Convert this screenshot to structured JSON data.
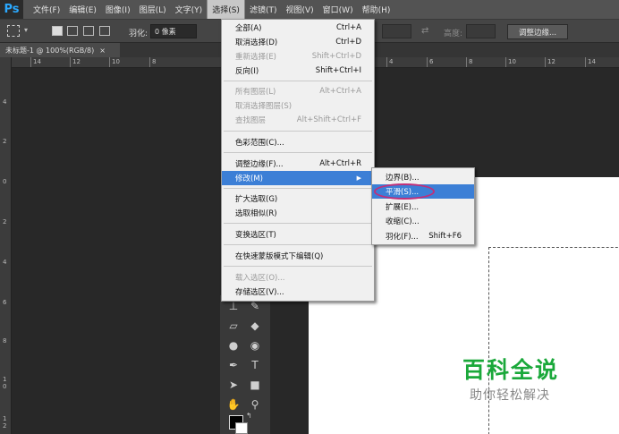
{
  "menubar": {
    "logo": "Ps",
    "items": [
      "文件(F)",
      "编辑(E)",
      "图像(I)",
      "图层(L)",
      "文字(Y)",
      "选择(S)",
      "滤镜(T)",
      "视图(V)",
      "窗口(W)",
      "帮助(H)"
    ],
    "active": "选择(S)"
  },
  "options": {
    "feather_label": "羽化:",
    "feather_value": "0 像素",
    "height_label": "高度:",
    "refine_button": "调整边缘..."
  },
  "document": {
    "tab_title": "未标题-1 @ 100%(RGB/8)",
    "close_glyph": "×"
  },
  "rulers": {
    "horizontal": [
      "14",
      "12",
      "10",
      "8",
      "4",
      "6",
      "8",
      "10",
      "12",
      "14"
    ],
    "vertical": [
      "4",
      "2",
      "0",
      "2",
      "4",
      "6",
      "8",
      "1 0",
      "1 2"
    ]
  },
  "select_menu": {
    "items": [
      {
        "label": "全部(A)",
        "shortcut": "Ctrl+A",
        "disabled": false
      },
      {
        "label": "取消选择(D)",
        "shortcut": "Ctrl+D",
        "disabled": false
      },
      {
        "label": "重新选择(E)",
        "shortcut": "Shift+Ctrl+D",
        "disabled": true
      },
      {
        "label": "反向(I)",
        "shortcut": "Shift+Ctrl+I",
        "disabled": false
      },
      {
        "label": "所有图层(L)",
        "shortcut": "Alt+Ctrl+A",
        "disabled": true
      },
      {
        "label": "取消选择图层(S)",
        "shortcut": "",
        "disabled": true
      },
      {
        "label": "查找图层",
        "shortcut": "Alt+Shift+Ctrl+F",
        "disabled": true
      },
      {
        "label": "色彩范围(C)...",
        "shortcut": "",
        "disabled": false
      },
      {
        "label": "调整边缘(F)...",
        "shortcut": "Alt+Ctrl+R",
        "disabled": false
      },
      {
        "label": "修改(M)",
        "shortcut": "",
        "disabled": false
      },
      {
        "label": "扩大选取(G)",
        "shortcut": "",
        "disabled": false
      },
      {
        "label": "选取相似(R)",
        "shortcut": "",
        "disabled": false
      },
      {
        "label": "变换选区(T)",
        "shortcut": "",
        "disabled": false
      },
      {
        "label": "在快速蒙版模式下编辑(Q)",
        "shortcut": "",
        "disabled": false
      },
      {
        "label": "载入选区(O)...",
        "shortcut": "",
        "disabled": true
      },
      {
        "label": "存储选区(V)...",
        "shortcut": "",
        "disabled": false
      }
    ],
    "highlighted": "修改(M)"
  },
  "modify_submenu": {
    "items": [
      {
        "label": "边界(B)...",
        "shortcut": ""
      },
      {
        "label": "平滑(S)...",
        "shortcut": ""
      },
      {
        "label": "扩展(E)...",
        "shortcut": ""
      },
      {
        "label": "收缩(C)...",
        "shortcut": ""
      },
      {
        "label": "羽化(F)...",
        "shortcut": "Shift+F6"
      }
    ],
    "highlighted": "平滑(S)...",
    "annotation_color": "#c0307a"
  },
  "toolbox": {
    "tools": [
      "stamp-icon",
      "history-brush-icon",
      "eraser-icon",
      "paint-bucket-icon",
      "blur-icon",
      "dodge-icon",
      "pen-icon",
      "type-icon",
      "path-select-icon",
      "rectangle-icon",
      "hand-icon",
      "zoom-icon"
    ],
    "type_glyph": "T"
  },
  "watermark": {
    "title": "百科全说",
    "subtitle": "助你轻松解决",
    "color": "#1aa83a"
  },
  "colors": {
    "highlight": "#3c7fd6",
    "menu_bg": "#f0f0f0",
    "app_bg": "#282828"
  }
}
